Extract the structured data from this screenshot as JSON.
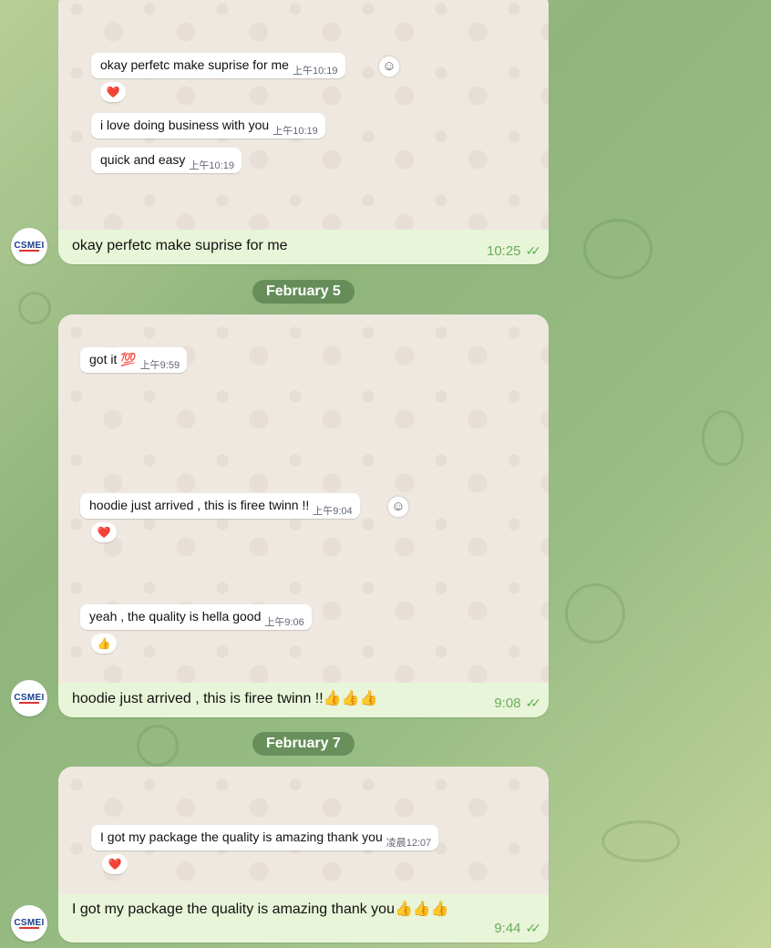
{
  "messages": [
    {
      "inner": [
        {
          "text": "okay perfetc make suprise for me",
          "time": "上午10:19",
          "reaction": "❤️"
        },
        {
          "text": "i love doing business with you",
          "time": "上午10:19"
        },
        {
          "text": "quick and easy",
          "time": "上午10:19"
        }
      ],
      "caption": "okay perfetc make suprise for me",
      "time": "10:25",
      "avatar": "CSMEI"
    },
    {
      "inner": [
        {
          "text": "got it 💯",
          "time": "上午9:59"
        },
        {
          "text": "hoodie just arrived , this is firee twinn !!",
          "time": "上午9:04",
          "reaction": "❤️"
        },
        {
          "text": "yeah , the quality is hella good",
          "time": "上午9:06",
          "reaction": "👍"
        }
      ],
      "caption": "hoodie just arrived , this is firee twinn !!👍👍👍",
      "time": "9:08",
      "avatar": "CSMEI"
    },
    {
      "inner": [
        {
          "text": "I got my package the quality is amazing thank you",
          "time": "凌晨12:07",
          "reaction": "❤️"
        }
      ],
      "caption": "I got my package the quality is amazing thank you👍👍👍",
      "time": "9:44",
      "avatar": "CSMEI"
    }
  ],
  "dates": [
    "February 5",
    "February 7"
  ],
  "icons": {
    "read_receipt": "double-check-icon",
    "reaction_picker": "smiley-icon"
  },
  "colors": {
    "bubble": "#e9f5d8",
    "time": "#6aab5e",
    "pill": "#658a58"
  }
}
